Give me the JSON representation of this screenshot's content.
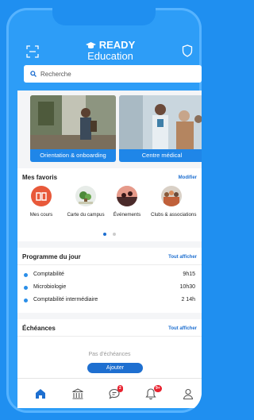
{
  "brand": {
    "line1": "READY",
    "line2": "Education"
  },
  "search": {
    "placeholder": "Recherche"
  },
  "banners": [
    {
      "caption": "Orientation & onboarding"
    },
    {
      "caption": "Centre médical"
    }
  ],
  "favorites": {
    "title": "Mes favoris",
    "edit_label": "Modifier",
    "items": [
      {
        "label": "Mes cours",
        "icon": "book-icon"
      },
      {
        "label": "Carte du campus",
        "icon": "campus-map-icon"
      },
      {
        "label": "Événements",
        "icon": "events-icon"
      },
      {
        "label": "Clubs & associations",
        "icon": "clubs-icon"
      }
    ],
    "page_count": 2,
    "active_page": 1
  },
  "schedule": {
    "title": "Programme du jour",
    "show_all": "Tout afficher",
    "items": [
      {
        "name": "Comptabilité",
        "time": "9h15"
      },
      {
        "name": "Microbiologie",
        "time": "10h30"
      },
      {
        "name": "Comptabilité intermédiaire",
        "time": "2 14h"
      }
    ]
  },
  "deadlines": {
    "title": "Échéances",
    "show_all": "Tout afficher",
    "empty_text": "Pas d'échéances",
    "add_label": "Ajouter"
  },
  "nav": {
    "items": [
      {
        "name": "home-icon"
      },
      {
        "name": "institution-icon"
      },
      {
        "name": "chat-icon",
        "badge": "2"
      },
      {
        "name": "bell-icon",
        "badge": "9+"
      },
      {
        "name": "profile-icon"
      }
    ]
  },
  "colors": {
    "accent": "#1e6fd0",
    "header": "#2d9df7",
    "badge": "#e8222f"
  }
}
